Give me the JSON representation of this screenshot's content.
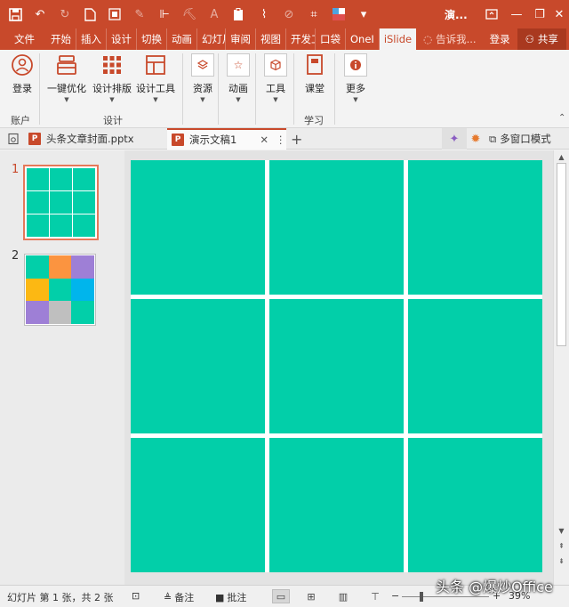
{
  "app": {
    "window_title": "演...",
    "accent": "#c8492b",
    "slide_color": "#02cfa9"
  },
  "qat": {
    "buttons": [
      "save-icon",
      "undo-icon",
      "redo-icon",
      "new-file-icon",
      "grid-icon",
      "pen-icon",
      "align-icon",
      "paint-icon",
      "text-icon",
      "paste-icon",
      "brush-icon",
      "eraser-icon",
      "crop-icon",
      "color-icon",
      "more-icon"
    ]
  },
  "ribbon_tabs": {
    "file": "文件",
    "items": [
      "开始",
      "插入",
      "设计",
      "切换",
      "动画",
      "幻灯片",
      "审阅",
      "视图",
      "开发工",
      "口袋",
      "OneI",
      "iSlide"
    ],
    "tell_me": "告诉我...",
    "login": "登录",
    "share": "共享"
  },
  "ribbon": {
    "login": "登录",
    "one_click": "一键优化",
    "design_layout": "设计排版",
    "design_tools": "设计工具",
    "resources": "资源",
    "animation": "动画",
    "tools": "工具",
    "classroom": "课堂",
    "more": "更多",
    "group_account": "账户",
    "group_design": "设计",
    "group_learn": "学习"
  },
  "doc_tabs": {
    "tab1": "头条文章封面.pptx",
    "tab2": "演示文稿1",
    "multi_window": "多窗口模式"
  },
  "slides": {
    "items": [
      {
        "number": "1",
        "colors": [
          "#02cfa9",
          "#02cfa9",
          "#02cfa9",
          "#02cfa9",
          "#02cfa9",
          "#02cfa9",
          "#02cfa9",
          "#02cfa9",
          "#02cfa9"
        ]
      },
      {
        "number": "2",
        "colors": [
          "#02cfa9",
          "#fb9440",
          "#9e7fd6",
          "#fcb813",
          "#02cfa9",
          "#00b5ec",
          "#9e7fd6",
          "#bfbfbf",
          "#02cfa9"
        ]
      }
    ]
  },
  "status": {
    "slide_info": "幻灯片 第 1 张，共 2 张",
    "notes": "备注",
    "comments": "批注",
    "zoom": "39%",
    "watermark": "头条 @爆炒Office"
  }
}
